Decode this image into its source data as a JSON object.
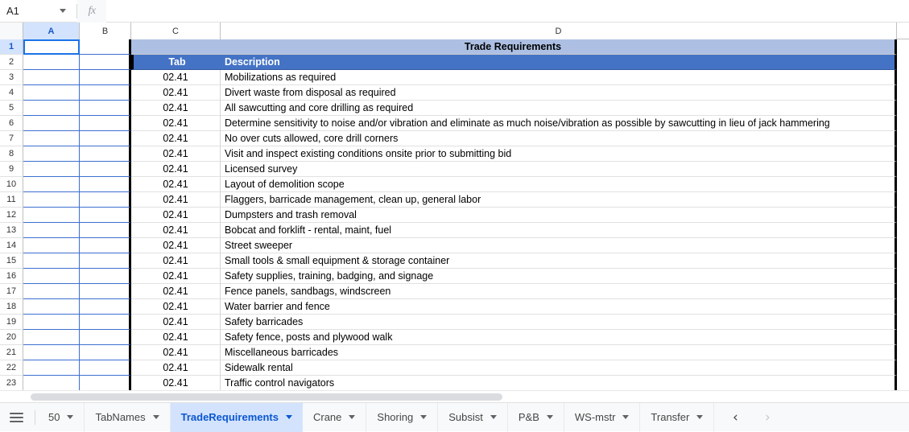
{
  "formula_bar": {
    "name_box_value": "A1",
    "name_box_caret_icon": "chevron-down-icon",
    "fx_label": "fx",
    "formula_value": "",
    "formula_placeholder": ""
  },
  "grid": {
    "column_headers": [
      "A",
      "B",
      "C",
      "D"
    ],
    "selected_column": "A",
    "selected_row": "1",
    "row_numbers": [
      "1",
      "2",
      "3",
      "4",
      "5",
      "6",
      "7",
      "8",
      "9",
      "10",
      "11",
      "12",
      "13",
      "14",
      "15",
      "16",
      "17",
      "18",
      "19",
      "20",
      "21",
      "22",
      "23"
    ],
    "title_row": {
      "row_number": "1",
      "text": "Trade Requirements"
    },
    "header_row": {
      "row_number": "2",
      "tab_label": "Tab",
      "description_label": "Description"
    },
    "colors": {
      "title_fill": "#adc0e4",
      "header_fill": "#4473c5",
      "header_text": "#ffffff",
      "selection_border": "#1a73e8",
      "custom_border_blue": "#3c6fd0",
      "thick_border_black": "#000000"
    },
    "rows": [
      {
        "row": "3",
        "tab": "02.41",
        "description": "Mobilizations as required"
      },
      {
        "row": "4",
        "tab": "02.41",
        "description": "Divert waste from disposal as required"
      },
      {
        "row": "5",
        "tab": "02.41",
        "description": "All sawcutting and core drilling as required"
      },
      {
        "row": "6",
        "tab": "02.41",
        "description": "Determine sensitivity to noise and/or vibration and eliminate as much noise/vibration as possible by sawcutting in lieu of jack hammering"
      },
      {
        "row": "7",
        "tab": "02.41",
        "description": "No over cuts allowed, core drill corners"
      },
      {
        "row": "8",
        "tab": "02.41",
        "description": "Visit and inspect existing conditions onsite prior to submitting bid"
      },
      {
        "row": "9",
        "tab": "02.41",
        "description": "Licensed survey"
      },
      {
        "row": "10",
        "tab": "02.41",
        "description": "Layout of demolition scope"
      },
      {
        "row": "11",
        "tab": "02.41",
        "description": "Flaggers, barricade management, clean up, general labor"
      },
      {
        "row": "12",
        "tab": "02.41",
        "description": "Dumpsters and trash removal"
      },
      {
        "row": "13",
        "tab": "02.41",
        "description": "Bobcat and forklift - rental, maint, fuel"
      },
      {
        "row": "14",
        "tab": "02.41",
        "description": "Street sweeper"
      },
      {
        "row": "15",
        "tab": "02.41",
        "description": "Small tools & small equipment & storage container"
      },
      {
        "row": "16",
        "tab": "02.41",
        "description": "Safety supplies, training, badging, and signage"
      },
      {
        "row": "17",
        "tab": "02.41",
        "description": "Fence panels, sandbags, windscreen"
      },
      {
        "row": "18",
        "tab": "02.41",
        "description": "Water barrier and fence"
      },
      {
        "row": "19",
        "tab": "02.41",
        "description": "Safety barricades"
      },
      {
        "row": "20",
        "tab": "02.41",
        "description": "Safety fence, posts and plywood walk"
      },
      {
        "row": "21",
        "tab": "02.41",
        "description": "Miscellaneous barricades"
      },
      {
        "row": "22",
        "tab": "02.41",
        "description": "Sidewalk rental"
      },
      {
        "row": "23",
        "tab": "02.41",
        "description": "Traffic control navigators"
      }
    ]
  },
  "tab_bar": {
    "all_sheets_icon": "hamburger-icon",
    "sheets": [
      {
        "label": "50",
        "active": false
      },
      {
        "label": "TabNames",
        "active": false
      },
      {
        "label": "TradeRequirements",
        "active": true
      },
      {
        "label": "Crane",
        "active": false
      },
      {
        "label": "Shoring",
        "active": false
      },
      {
        "label": "Subsist",
        "active": false
      },
      {
        "label": "P&B",
        "active": false
      },
      {
        "label": "WS-mstr",
        "active": false
      },
      {
        "label": "Transfer",
        "active": false
      }
    ],
    "prev_arrow_icon": "chevron-left-icon",
    "next_arrow_icon": "chevron-right-icon",
    "prev_arrow_label": "‹",
    "next_arrow_label": "›"
  }
}
